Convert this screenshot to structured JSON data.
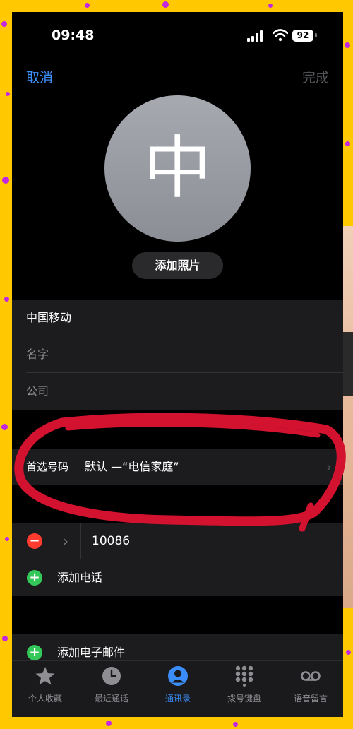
{
  "status": {
    "time": "09:48",
    "battery": "92"
  },
  "nav": {
    "cancel": "取消",
    "done": "完成"
  },
  "avatar": {
    "initial": "中",
    "add_photo": "添加照片"
  },
  "fields": [
    {
      "value": "中国移动",
      "placeholder": false
    },
    {
      "value": "名字",
      "placeholder": true
    },
    {
      "value": "公司",
      "placeholder": true
    }
  ],
  "preferred": {
    "label": "首选号码",
    "value": "默认 —“电信家庭”"
  },
  "phones": [
    {
      "number": "10086"
    }
  ],
  "add_phone": "添加电话",
  "add_email": "添加电子邮件",
  "tabs": [
    {
      "icon": "star-icon",
      "label": "个人收藏",
      "active": false
    },
    {
      "icon": "clock-icon",
      "label": "最近通话",
      "active": false
    },
    {
      "icon": "person-icon",
      "label": "通讯录",
      "active": true
    },
    {
      "icon": "keypad-icon",
      "label": "拨号键盘",
      "active": false
    },
    {
      "icon": "voicemail-icon",
      "label": "语音留言",
      "active": false
    }
  ],
  "colors": {
    "accent": "#3b8df7",
    "frame": "#ffc800",
    "confetti": "#c326e0",
    "annotation": "#d3122f",
    "delete": "#ff3b30",
    "add": "#34c759"
  }
}
